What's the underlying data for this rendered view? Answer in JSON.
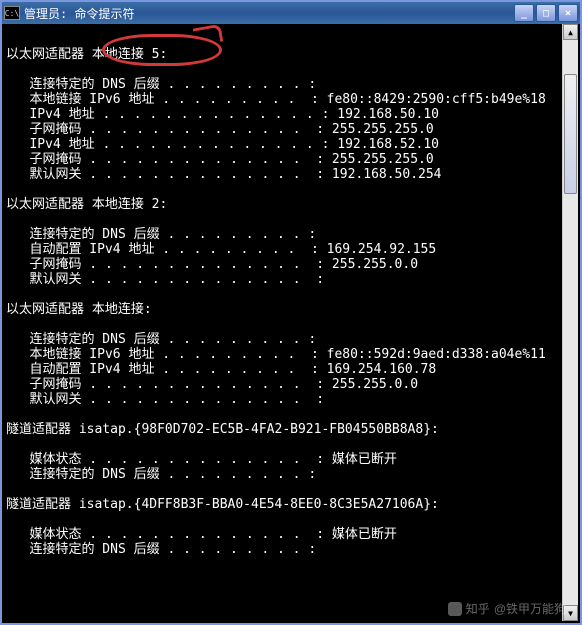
{
  "window": {
    "title_prefix": "管理员: ",
    "title_app": "命令提示符",
    "icon_label": "C:\\"
  },
  "adapters": [
    {
      "header": "以太网适配器 本地连接 5:",
      "rows": [
        {
          "label": "连接特定的 DNS 后缀",
          "value": ""
        },
        {
          "label": "本地链接 IPv6 地址",
          "value": "fe80::8429:2590:cff5:b49e%18"
        },
        {
          "label": "IPv4 地址",
          "value": "192.168.50.10"
        },
        {
          "label": "子网掩码",
          "value": "255.255.255.0"
        },
        {
          "label": "IPv4 地址",
          "value": "192.168.52.10"
        },
        {
          "label": "子网掩码",
          "value": "255.255.255.0"
        },
        {
          "label": "默认网关",
          "value": "192.168.50.254"
        }
      ]
    },
    {
      "header": "以太网适配器 本地连接 2:",
      "rows": [
        {
          "label": "连接特定的 DNS 后缀",
          "value": ""
        },
        {
          "label": "自动配置 IPv4 地址",
          "value": "169.254.92.155"
        },
        {
          "label": "子网掩码",
          "value": "255.255.0.0"
        },
        {
          "label": "默认网关",
          "value": ""
        }
      ]
    },
    {
      "header": "以太网适配器 本地连接:",
      "rows": [
        {
          "label": "连接特定的 DNS 后缀",
          "value": ""
        },
        {
          "label": "本地链接 IPv6 地址",
          "value": "fe80::592d:9aed:d338:a04e%11"
        },
        {
          "label": "自动配置 IPv4 地址",
          "value": "169.254.160.78"
        },
        {
          "label": "子网掩码",
          "value": "255.255.0.0"
        },
        {
          "label": "默认网关",
          "value": ""
        }
      ]
    },
    {
      "header": "隧道适配器 isatap.{98F0D702-EC5B-4FA2-B921-FB04550BB8A8}:",
      "rows": [
        {
          "label": "媒体状态",
          "value": "媒体已断开"
        },
        {
          "label": "连接特定的 DNS 后缀",
          "value": ""
        }
      ]
    },
    {
      "header": "隧道适配器 isatap.{4DFF8B3F-BBA0-4E54-8EE0-8C3E5A27106A}:",
      "rows": [
        {
          "label": "媒体状态",
          "value": "媒体已断开"
        },
        {
          "label": "连接特定的 DNS 后缀",
          "value": ""
        }
      ]
    }
  ],
  "watermark": {
    "prefix": "知乎",
    "author": "@铁甲万能狗"
  },
  "layout": {
    "colon_col": 40,
    "indent": "   "
  }
}
